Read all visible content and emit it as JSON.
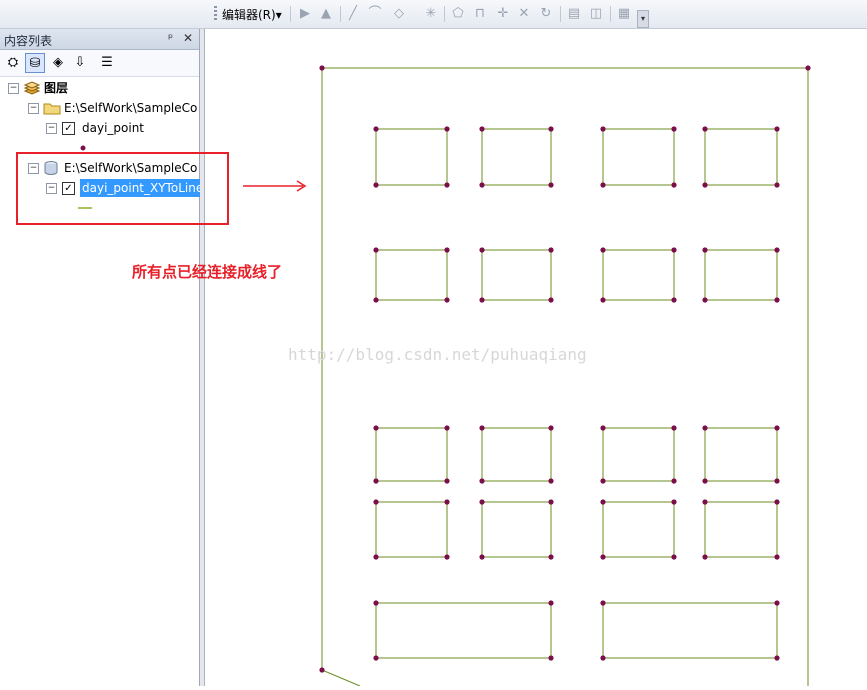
{
  "toolbar": {
    "editor_label": "编辑器(R)",
    "editor_dropdown": "▾",
    "tools": [
      "edit-tool-icon",
      "edit-annotation-icon",
      "straight-segment-icon",
      "arc-segment-icon",
      "vertex-icon",
      "split-icon",
      "reshape-icon",
      "cut-polygon-icon",
      "split-line-icon",
      "rotate-icon",
      "attributes-icon",
      "sketch-properties-icon",
      "editor-toolbar-more-icon"
    ]
  },
  "toc": {
    "title": "内容列表",
    "pin": "ᵖ",
    "close": "✕",
    "root_label": "图层",
    "groups": [
      {
        "path": "E:\\SelfWork\\SampleCo",
        "layer": "dayi_point"
      },
      {
        "path": "E:\\SelfWork\\SampleCo",
        "layer": "dayi_point_XYToLine"
      }
    ]
  },
  "annotation": {
    "text": "所有点已经连接成线了",
    "color": "#e8202a"
  },
  "watermark": "http://blog.csdn.net/puhuaqiang",
  "colors": {
    "line": "#6b8e23",
    "point": "#7a0f4b",
    "selection": "#3399ff"
  }
}
